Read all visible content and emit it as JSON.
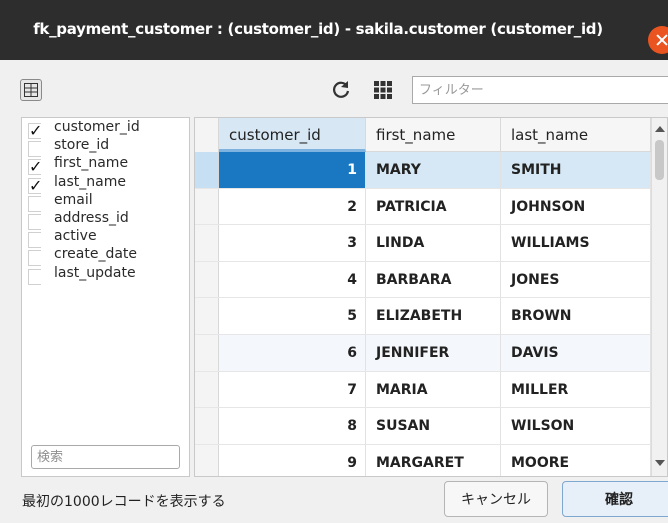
{
  "window": {
    "title": "fk_payment_customer : (customer_id) - sakila.customer (customer_id)"
  },
  "toolbar": {
    "filter_placeholder": "フィルター",
    "icons": [
      "columns-toggle-icon",
      "refresh-icon",
      "grid-icon"
    ]
  },
  "columns_panel": {
    "items": [
      {
        "label": "customer_id",
        "checked": true
      },
      {
        "label": "store_id",
        "checked": false
      },
      {
        "label": "first_name",
        "checked": true
      },
      {
        "label": "last_name",
        "checked": true
      },
      {
        "label": "email",
        "checked": false
      },
      {
        "label": "address_id",
        "checked": false
      },
      {
        "label": "active",
        "checked": false
      },
      {
        "label": "create_date",
        "checked": false
      },
      {
        "label": "last_update",
        "checked": false
      }
    ],
    "search_placeholder": "検索"
  },
  "table": {
    "headers": [
      "customer_id",
      "first_name",
      "last_name"
    ],
    "rows": [
      {
        "customer_id": "1",
        "first_name": "MARY",
        "last_name": "SMITH"
      },
      {
        "customer_id": "2",
        "first_name": "PATRICIA",
        "last_name": "JOHNSON"
      },
      {
        "customer_id": "3",
        "first_name": "LINDA",
        "last_name": "WILLIAMS"
      },
      {
        "customer_id": "4",
        "first_name": "BARBARA",
        "last_name": "JONES"
      },
      {
        "customer_id": "5",
        "first_name": "ELIZABETH",
        "last_name": "BROWN"
      },
      {
        "customer_id": "6",
        "first_name": "JENNIFER",
        "last_name": "DAVIS"
      },
      {
        "customer_id": "7",
        "first_name": "MARIA",
        "last_name": "MILLER"
      },
      {
        "customer_id": "8",
        "first_name": "SUSAN",
        "last_name": "WILSON"
      },
      {
        "customer_id": "9",
        "first_name": "MARGARET",
        "last_name": "MOORE"
      }
    ]
  },
  "footer": {
    "status": "最初の1000レコードを表示する",
    "cancel_label": "キャンセル",
    "ok_label": "確認"
  },
  "colors": {
    "titlebar": "#2d2d2d",
    "close": "#e95420",
    "selected_cell": "#1a78c2",
    "selected_row": "#d6e8f5"
  }
}
